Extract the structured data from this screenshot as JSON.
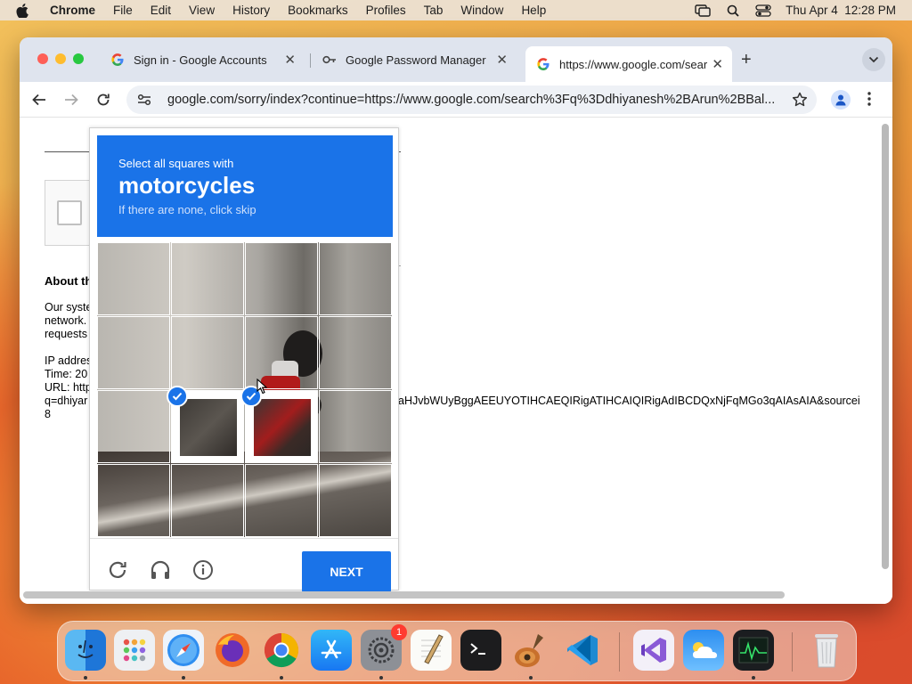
{
  "menubar": {
    "app_name": "Chrome",
    "items": [
      "File",
      "Edit",
      "View",
      "History",
      "Bookmarks",
      "Profiles",
      "Tab",
      "Window",
      "Help"
    ],
    "datetime": "Thu Apr 4  12:28 PM"
  },
  "tabs": [
    {
      "title": "Sign in - Google Accounts",
      "icon": "google-g-icon"
    },
    {
      "title": "Google Password Manager",
      "icon": "key-icon"
    },
    {
      "title": "https://www.google.com/sear",
      "icon": "google-g-icon",
      "active": true
    }
  ],
  "toolbar": {
    "url": "google.com/sorry/index?continue=https://www.google.com/search%3Fq%3Ddhiyanesh%2BArun%2BBal..."
  },
  "page": {
    "about_heading": "About th",
    "body_lines": [
      "Our syste",
      "network.",
      "requests"
    ],
    "ip_line": "IP addres",
    "time_line": "Time: 20",
    "url_line": "URL: http",
    "q_line": "q=dhiyar",
    "digit_line": "8",
    "url_tail": "aHJvbWUyBggAEEUYOTIHCAEQIRigATIHCAIQIRigAdIBCDQxNjFqMGo3qAIAsAIA&sourcei"
  },
  "captcha": {
    "line1": "Select all squares with",
    "target": "motorcycles",
    "line3": "If there are none, click skip",
    "next_label": "NEXT",
    "selected_cells": [
      9,
      10
    ]
  },
  "dock": {
    "apps": [
      "Finder",
      "Launchpad",
      "Safari",
      "Firefox",
      "Chrome",
      "App Store",
      "System Settings",
      "TextEdit",
      "Terminal",
      "Instruments",
      "Visual Studio Code",
      "Visual Studio",
      "Weather",
      "Activity Monitor",
      "Trash"
    ],
    "system_settings_badge": "1"
  },
  "colors": {
    "accent": "#1a73e8",
    "traffic_red": "#fe5f57",
    "traffic_yellow": "#febc2e",
    "traffic_green": "#28c840"
  }
}
